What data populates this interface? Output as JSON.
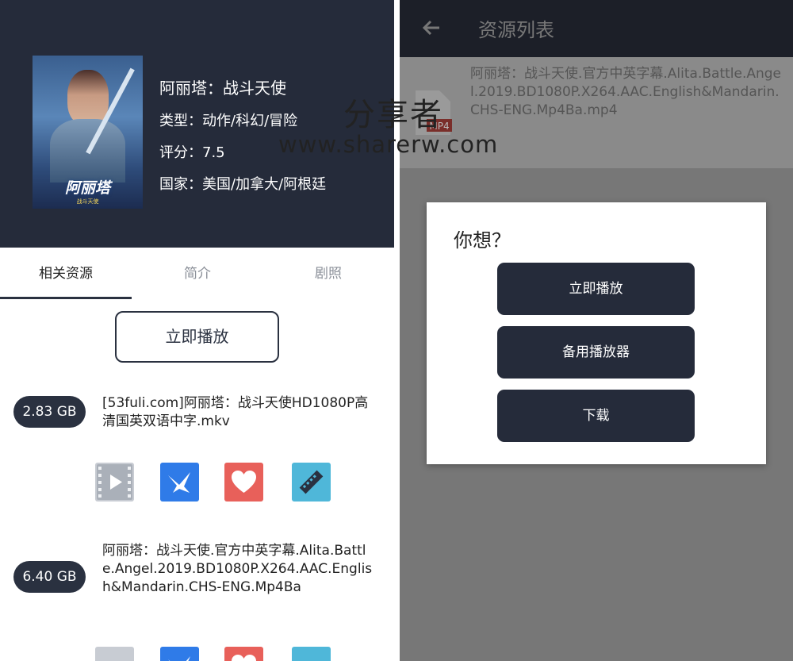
{
  "movie": {
    "title": "阿丽塔：战斗天使",
    "genre": "类型：动作/科幻/冒险",
    "score": "评分：7.5",
    "country": "国家：美国/加拿大/阿根廷",
    "poster_title": "阿丽塔",
    "poster_subtitle": "战斗天使"
  },
  "tabs": [
    "相关资源",
    "简介",
    "剧照"
  ],
  "play_button": "立即播放",
  "resources": [
    {
      "size": "2.83 GB",
      "name": "[53fuli.com]阿丽塔：战斗天使HD1080P高清国英双语中字.mkv"
    },
    {
      "size": "6.40 GB",
      "name": "阿丽塔：战斗天使.官方中英字幕.Alita.Battle.Angel.2019.BD1080P.X264.AAC.English&Mandarin.CHS-ENG.Mp4Ba"
    }
  ],
  "action_icons": [
    {
      "name": "video-play-icon",
      "color": "#c8ccd3"
    },
    {
      "name": "thunder-bird-icon",
      "color": "#2f7be8"
    },
    {
      "name": "heart-icon",
      "color": "#e8605a"
    },
    {
      "name": "film-icon",
      "color": "#4fb7d9"
    }
  ],
  "right_panel": {
    "appbar_title": "资源列表",
    "file_badge": "MP4",
    "list_item": "阿丽塔：战斗天使.官方中英字幕.Alita.Battle.Angel.2019.BD1080P.X264.AAC.English&Mandarin.CHS-ENG.Mp4Ba.mp4",
    "dialog_title": "你想？",
    "dialog_options": [
      "立即播放",
      "备用播放器",
      "下载"
    ]
  },
  "watermark": {
    "line1": "分享者",
    "line2": "www.sharerw.com"
  }
}
